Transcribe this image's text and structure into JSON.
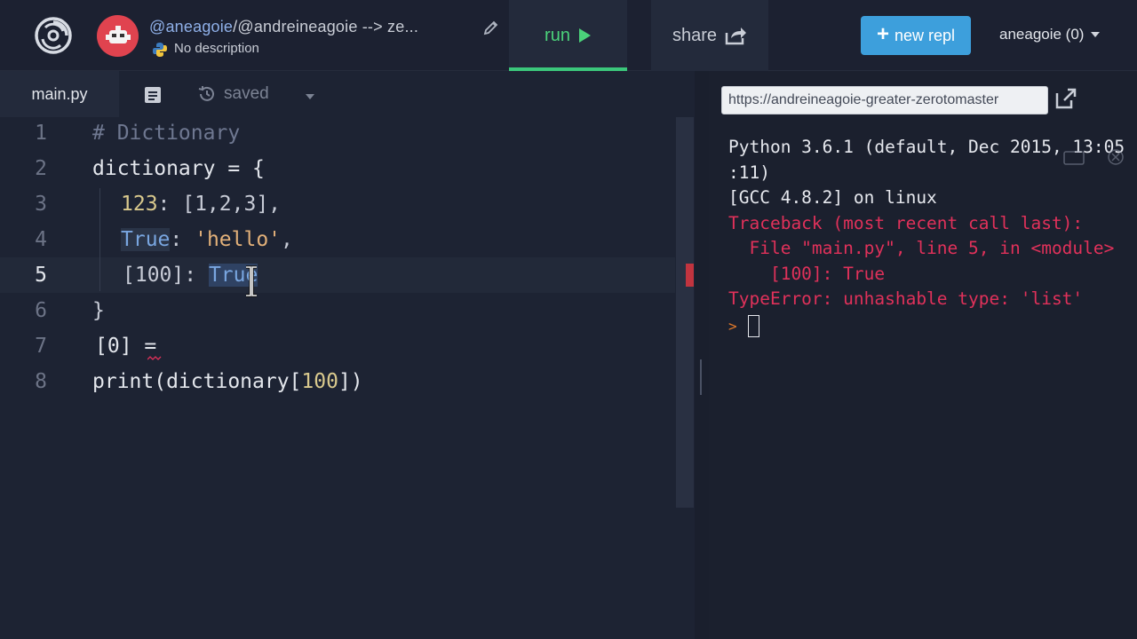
{
  "header": {
    "owner": "@aneagoie",
    "repl_path": "/@andreineagoie --> ze...",
    "description": "No description",
    "run_label": "run",
    "share_label": "share",
    "new_repl_label": "new repl",
    "user_menu_label": "aneagoie (0)"
  },
  "editor": {
    "file_tab": "main.py",
    "saved_label": "saved",
    "line_numbers": [
      "1",
      "2",
      "3",
      "4",
      "5",
      "6",
      "7",
      "8"
    ],
    "lines": {
      "l1": "# Dictionary",
      "l2": "dictionary = {",
      "l3_num": "123",
      "l3_rest": ": [1,2,3],",
      "l4_key": "True",
      "l4_colon": ": ",
      "l4_str": "'hello'",
      "l4_comma": ",",
      "l5_key": "[100]: ",
      "l5_val": "True",
      "l6": "}",
      "l7": "[0] =",
      "l8_fn": "print(dictionary[",
      "l8_num": "100",
      "l8_end": "])"
    }
  },
  "console": {
    "url": "https://andreineagoie-greater-zerotomaster",
    "lines": [
      "Python 3.6.1 (default, Dec 2015, 13:05",
      ":11)",
      "[GCC 4.8.2] on linux"
    ],
    "errors": [
      "Traceback (most recent call last):",
      "  File \"main.py\", line 5, in <module>",
      "    [100]: True",
      "TypeError: unhashable type: 'list'"
    ],
    "prompt": ">"
  },
  "colors": {
    "run_accent": "#4bd27a",
    "new_repl_bg": "#3d9fdc",
    "error_red": "#e0315a",
    "avatar_red": "#e0434f"
  },
  "icons": [
    "repl-logo-icon",
    "robot-avatar-icon",
    "pencil-icon",
    "python-icon",
    "play-icon",
    "share-icon",
    "plus-icon",
    "chevron-down-icon",
    "files-icon",
    "history-icon",
    "open-new-tab-icon",
    "text-cursor-icon"
  ]
}
